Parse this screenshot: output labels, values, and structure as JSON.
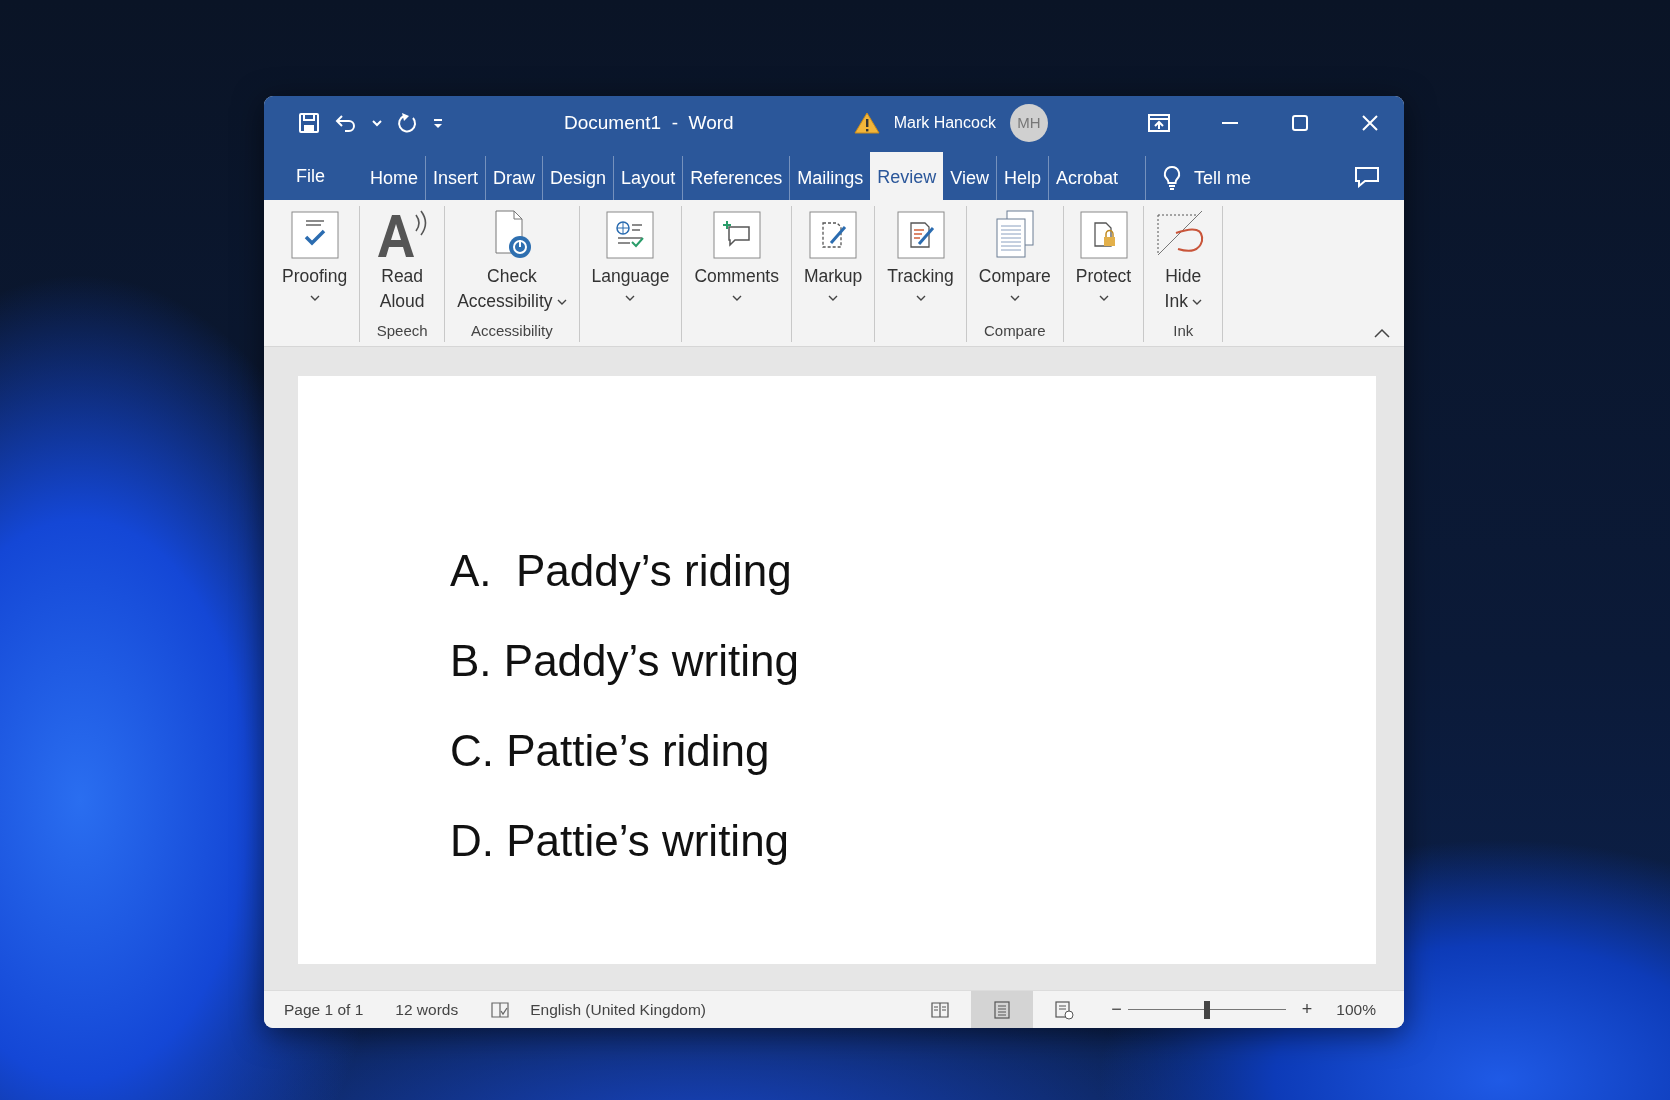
{
  "window": {
    "title": "Document1  -  Word"
  },
  "quick_access": [
    {
      "kind": "save"
    },
    {
      "kind": "undo"
    },
    {
      "kind": "undo_menu"
    },
    {
      "kind": "redo"
    },
    {
      "kind": "customize"
    }
  ],
  "account": {
    "warning": true,
    "user": "Mark Hancock",
    "initials": "MH"
  },
  "tabs": [
    {
      "label": "File",
      "kind": "file",
      "selected": false
    },
    {
      "label": "Home",
      "kind": "tab",
      "selected": false
    },
    {
      "label": "Insert",
      "kind": "tab",
      "selected": false
    },
    {
      "label": "Draw",
      "kind": "tab",
      "selected": false
    },
    {
      "label": "Design",
      "kind": "tab",
      "selected": false
    },
    {
      "label": "Layout",
      "kind": "tab",
      "selected": false
    },
    {
      "label": "References",
      "kind": "tab",
      "selected": false
    },
    {
      "label": "Mailings",
      "kind": "tab",
      "selected": false
    },
    {
      "label": "Review",
      "kind": "tab",
      "selected": true
    },
    {
      "label": "View",
      "kind": "tab",
      "selected": false
    },
    {
      "label": "Help",
      "kind": "tab",
      "selected": false
    },
    {
      "label": "Acrobat",
      "kind": "tab",
      "selected": false
    }
  ],
  "tell_me": "Tell me",
  "ribbon": {
    "groups": [
      {
        "buttons": [
          {
            "label": "Proofing",
            "kind": "proofing",
            "dropdown": true
          }
        ]
      },
      {
        "label": "Speech",
        "buttons": [
          {
            "label": "Read\nAloud",
            "kind": "read_aloud",
            "dropdown": false
          }
        ]
      },
      {
        "label": "Accessibility",
        "buttons": [
          {
            "label": "Check\nAccessibility",
            "kind": "accessibility",
            "dropdown": true
          }
        ]
      },
      {
        "buttons": [
          {
            "label": "Language",
            "kind": "language",
            "dropdown": true
          }
        ]
      },
      {
        "buttons": [
          {
            "label": "Comments",
            "kind": "comments",
            "dropdown": true
          }
        ]
      },
      {
        "buttons": [
          {
            "label": "Markup",
            "kind": "markup",
            "dropdown": true
          }
        ]
      },
      {
        "buttons": [
          {
            "label": "Tracking",
            "kind": "tracking",
            "dropdown": true
          }
        ]
      },
      {
        "label": "Compare",
        "buttons": [
          {
            "label": "Compare",
            "kind": "compare",
            "dropdown": true
          }
        ]
      },
      {
        "buttons": [
          {
            "label": "Protect",
            "kind": "protect",
            "dropdown": true
          }
        ]
      },
      {
        "label": "Ink",
        "buttons": [
          {
            "label": "Hide\nInk",
            "kind": "ink",
            "dropdown": true
          }
        ]
      }
    ]
  },
  "document": {
    "paragraphs": [
      "A.  Paddy’s riding",
      "B. Paddy’s writing",
      "C. Pattie’s riding",
      "D. Pattie’s writing"
    ]
  },
  "status_bar": {
    "page": "Page 1 of 1",
    "words": "12 words",
    "language": "English (United Kingdom)",
    "views": [
      {
        "kind": "read",
        "selected": false
      },
      {
        "kind": "print",
        "selected": true
      },
      {
        "kind": "web",
        "selected": false
      }
    ],
    "zoom_out": "−",
    "zoom_in": "+",
    "zoom": {
      "level": 0.5
    },
    "zoom_text": "100%"
  }
}
